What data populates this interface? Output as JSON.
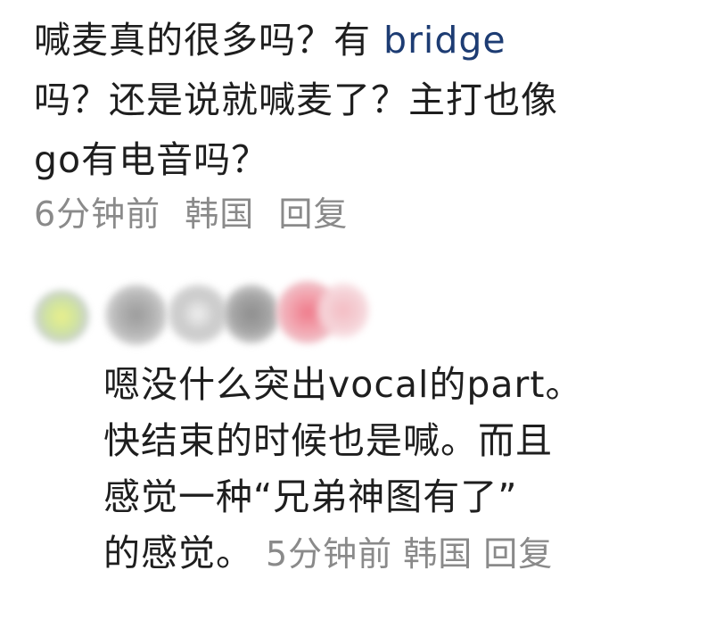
{
  "comment1": {
    "line1_pre": "喊麦真的很多吗？有 ",
    "link": "bridge",
    "line2": "吗？还是说就喊麦了？主打也像",
    "line3": "go有电音吗？",
    "time": "6分钟前",
    "location": "韩国",
    "reply": "回复"
  },
  "comment2": {
    "line1": "嗯没什么突出vocal的part。",
    "line2": "快结束的时候也是喊。而且",
    "line3": "感觉一种“兄弟神图有了”",
    "line4": "的感觉。",
    "time": "5分钟前",
    "location": "韩国",
    "reply": "回复"
  },
  "colors": {
    "text": "#1e1e1e",
    "meta": "#8a8a8a",
    "link": "#1d3c73"
  }
}
